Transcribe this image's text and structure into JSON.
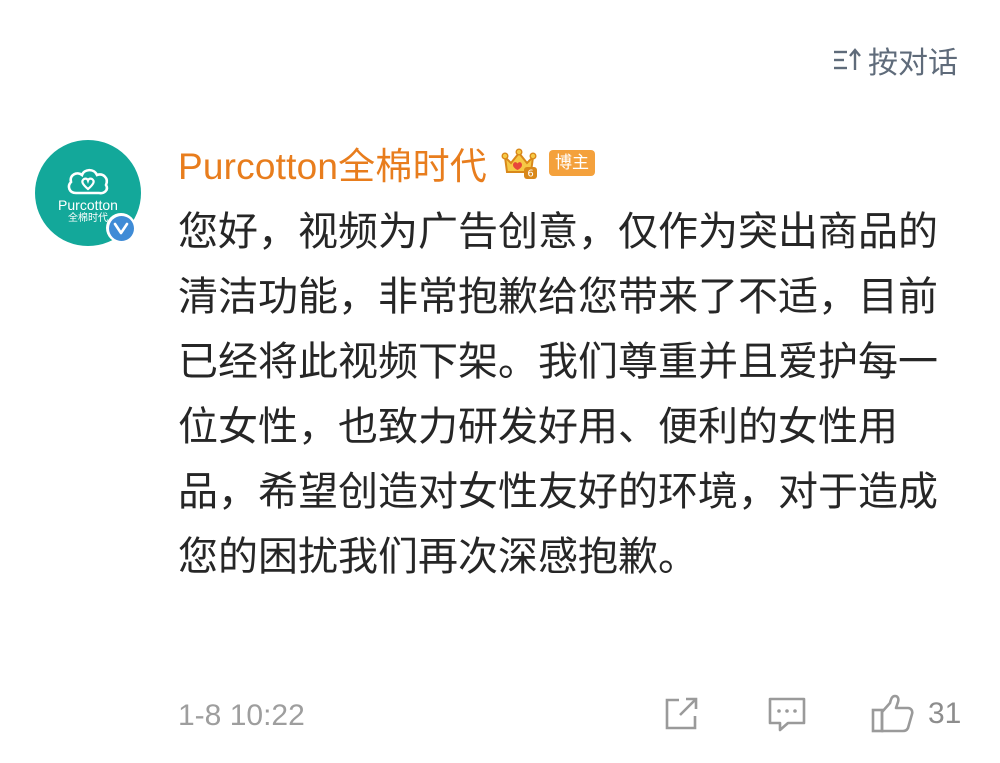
{
  "header": {
    "sort_label": "按对话"
  },
  "comment": {
    "avatar": {
      "brand_name": "Purcotton",
      "brand_sub": "全棉时代"
    },
    "username": "Purcotton全棉时代",
    "author_badge": "博主",
    "text": "您好，视频为广告创意，仅作为突出商品的清洁功能，非常抱歉给您带来了不适，目前已经将此视频下架。我们尊重并且爱护每一位女性，也致力研发好用、便利的女性用品，希望创造对女性友好的环境，对于造成您的困扰我们再次深感抱歉。",
    "timestamp": "1-8 10:22",
    "like_count": "31"
  },
  "icons": {
    "sort": "sort-icon",
    "verified": "verified-icon",
    "crown": "crown-level-icon",
    "share": "share-icon",
    "reply": "comment-icon",
    "like": "thumbs-up-icon"
  },
  "colors": {
    "username": "#e87d1d",
    "author_badge": "#f4a13c",
    "avatar_bg": "#13a89a",
    "verified": "#3f8bd6",
    "muted": "#a3a3a3"
  }
}
